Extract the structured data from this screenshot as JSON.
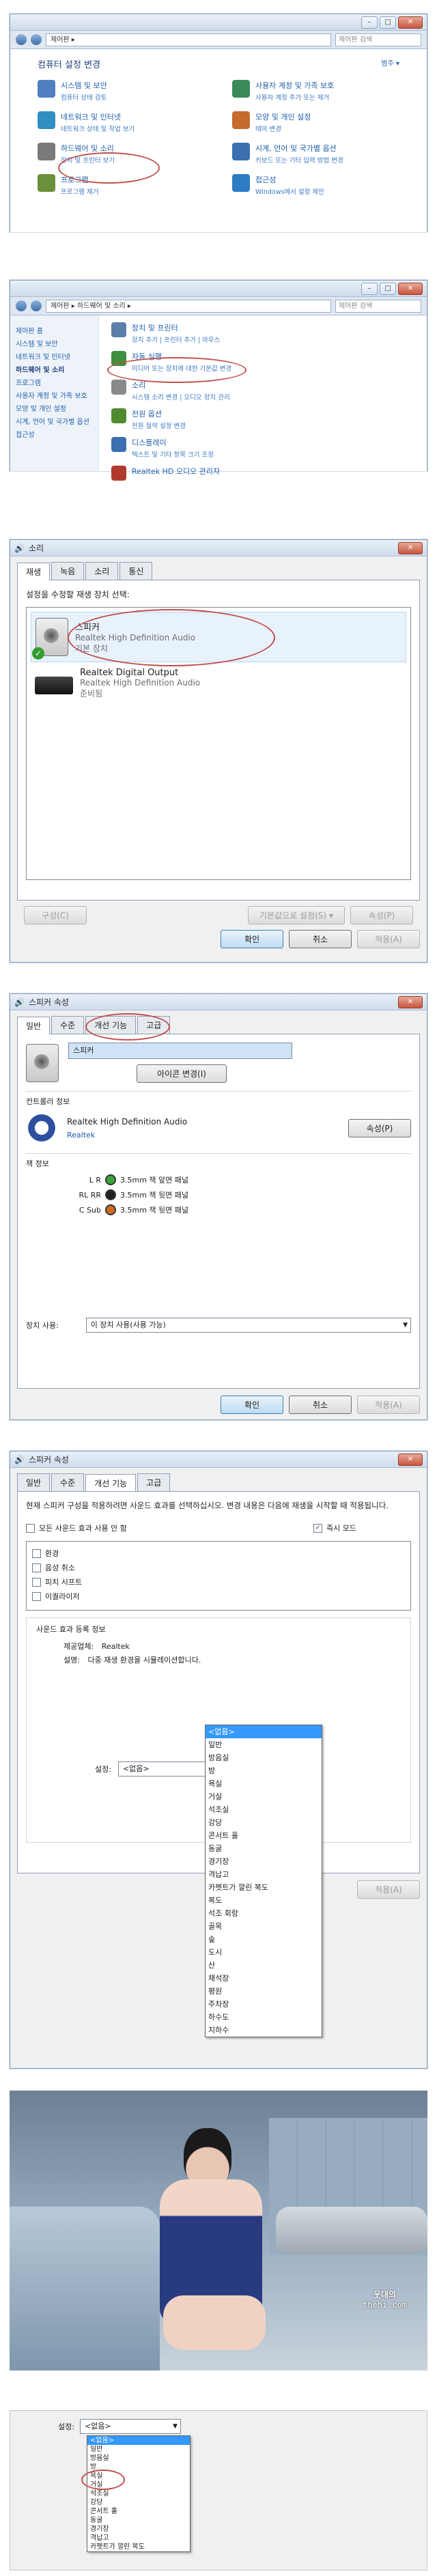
{
  "control_panel": {
    "breadcrumb": "제어판 ▸",
    "search_placeholder": "제어판 검색",
    "heading": "컴퓨터 설정 변경",
    "view_by": "범주 ▾",
    "categories_left": [
      {
        "title": "시스템 및 보안",
        "sub": "컴퓨터 상태 검토",
        "color": "#4f7fc1"
      },
      {
        "title": "네트워크 및 인터넷",
        "sub": "네트워크 상태 및 작업 보기",
        "color": "#2e8fc0"
      },
      {
        "title": "하드웨어 및 소리",
        "sub": "장치 및 프린터 보기",
        "color": "#7a7a7a"
      },
      {
        "title": "프로그램",
        "sub": "프로그램 제거",
        "color": "#6b8f3a"
      }
    ],
    "categories_right": [
      {
        "title": "사용자 계정 및 가족 보호",
        "sub": "사용자 계정 추가 또는 제거",
        "color": "#3a8a5a"
      },
      {
        "title": "모양 및 개인 설정",
        "sub": "테마 변경",
        "color": "#c56b2e"
      },
      {
        "title": "시계, 언어 및 국가별 옵션",
        "sub": "키보드 또는 기타 입력 방법 변경",
        "color": "#3a6fb0"
      },
      {
        "title": "접근성",
        "sub": "Windows에서 설정 제안",
        "color": "#2d7cc4"
      }
    ]
  },
  "hardware_sound": {
    "breadcrumb": "제어판 ▸ 하드웨어 및 소리 ▸",
    "search_placeholder": "제어판 검색",
    "sidebar": [
      "제어판 홈",
      "시스템 및 보안",
      "네트워크 및 인터넷",
      "하드웨어 및 소리",
      "프로그램",
      "사용자 계정 및 가족 보호",
      "모양 및 개인 설정",
      "시계, 언어 및 국가별 옵션",
      "접근성"
    ],
    "items": [
      {
        "title": "장치 및 프린터",
        "sub": "장치 추가 | 프린터 추가 | 마우스",
        "color": "#5a7fa8"
      },
      {
        "title": "자동 실행",
        "sub": "미디어 또는 장치에 대한 기본값 변경",
        "color": "#3f8f3f"
      },
      {
        "title": "소리",
        "sub": "시스템 소리 변경 | 오디오 장치 관리",
        "color": "#8a8a8a"
      },
      {
        "title": "전원 옵션",
        "sub": "전원 절약 설정 변경",
        "color": "#4f8a2f"
      },
      {
        "title": "디스플레이",
        "sub": "텍스트 및 기타 항목 크기 조정",
        "color": "#3a6fb0"
      },
      {
        "title": "Realtek HD 오디오 관리자",
        "sub": "",
        "color": "#b03a2e"
      }
    ]
  },
  "sound_dialog": {
    "title": "소리",
    "tabs": [
      "재생",
      "녹음",
      "소리",
      "통신"
    ],
    "instruction": "설정을 수정할 재생 장치 선택:",
    "devices": [
      {
        "name": "스피커",
        "driver": "Realtek High Definition Audio",
        "status": "기본 장치"
      },
      {
        "name": "Realtek Digital Output",
        "driver": "Realtek High Definition Audio",
        "status": "준비됨"
      }
    ],
    "configure": "구성(C)",
    "set_default": "기본값으로 설정(S) ▾",
    "properties": "속성(P)",
    "ok": "확인",
    "cancel": "취소",
    "apply": "적용(A)"
  },
  "speaker_props": {
    "title": "스피커 속성",
    "tabs": [
      "일반",
      "수준",
      "개선 기능",
      "고급"
    ],
    "name_value": "스피커",
    "change_icon": "아이콘 변경(I)",
    "controller_label": "컨트롤러 정보",
    "controller_name": "Realtek High Definition Audio",
    "controller_vendor": "Realtek",
    "properties": "속성(P)",
    "jack_label": "잭 정보",
    "jacks": [
      {
        "ch": "L R",
        "desc": "3.5mm 잭 앞면 패널",
        "color": "#3aa53a"
      },
      {
        "ch": "RL RR",
        "desc": "3.5mm 잭 뒷면 패널",
        "color": "#222222"
      },
      {
        "ch": "C Sub",
        "desc": "3.5mm 잭 뒷면 패널",
        "color": "#d06a1e"
      }
    ],
    "device_usage_label": "장치 사용:",
    "device_usage_value": "이 장치 사용(사용 가능)",
    "ok": "확인",
    "cancel": "취소",
    "apply": "적용(A)"
  },
  "enhancements": {
    "title": "스피커 속성",
    "tabs": [
      "일반",
      "수준",
      "개선 기능",
      "고급"
    ],
    "description": "현재 스피커 구성을 적용하려면 사운드 효과를 선택하십시오. 변경 내용은 다음에 재생을 시작할 때 적용됩니다.",
    "disable_all": "모든 사운드 효과 사용 안 함",
    "immediate": "즉시 모드",
    "effects": [
      "환경",
      "음성 취소",
      "피치 시프트",
      "이퀄라이저"
    ],
    "props_label": "사운드 효과 등록 정보",
    "provider_label": "제공업체:",
    "provider_value": "Realtek",
    "desc_label": "설명:",
    "desc_value": "다중 재생 환경을 시뮬레이션합니다.",
    "setting_label": "설정:",
    "setting_value": "<없음>",
    "apply": "적용(A)",
    "options": [
      "<없음>",
      "일반",
      "방음실",
      "방",
      "욕실",
      "거실",
      "석조실",
      "강당",
      "콘서트 홀",
      "동굴",
      "경기장",
      "격납고",
      "카펫트가 깔린 복도",
      "복도",
      "석조 회랑",
      "골목",
      "숲",
      "도시",
      "산",
      "채석장",
      "평원",
      "주차장",
      "하수도",
      "지하수"
    ]
  },
  "photo": {
    "watermark_line1": "웃대의",
    "watermark_line2": "thehi.com"
  },
  "zoom": {
    "setting_label": "설정:",
    "setting_value": "<없음>",
    "options": [
      "<없음>",
      "일반",
      "방음실",
      "방",
      "욕실",
      "거실",
      "석조실",
      "강당",
      "콘서트 홀",
      "동굴",
      "경기장",
      "격납고",
      "카펫트가 깔린 복도"
    ]
  }
}
